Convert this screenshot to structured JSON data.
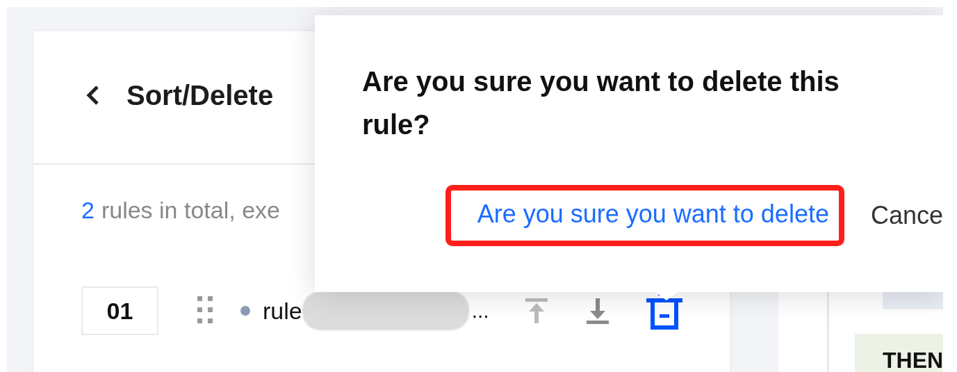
{
  "header": {
    "title": "Sort/Delete"
  },
  "summary": {
    "count": "2",
    "text": "rules in total, exe"
  },
  "rules": [
    {
      "index": "01",
      "name": "rule",
      "ellipsis": "...",
      "actions": [
        {
          "kind": "top",
          "disabled": true,
          "active": false
        },
        {
          "kind": "bottom",
          "disabled": false,
          "active": false
        },
        {
          "kind": "delete",
          "disabled": false,
          "active": true
        }
      ]
    }
  ],
  "side_panel": {
    "label": "THEN"
  },
  "popconfirm": {
    "title": "Are you sure you want to delete this rule?",
    "confirm": "Are you sure you want to delete",
    "cancel": "Cance",
    "highlighted": true
  }
}
